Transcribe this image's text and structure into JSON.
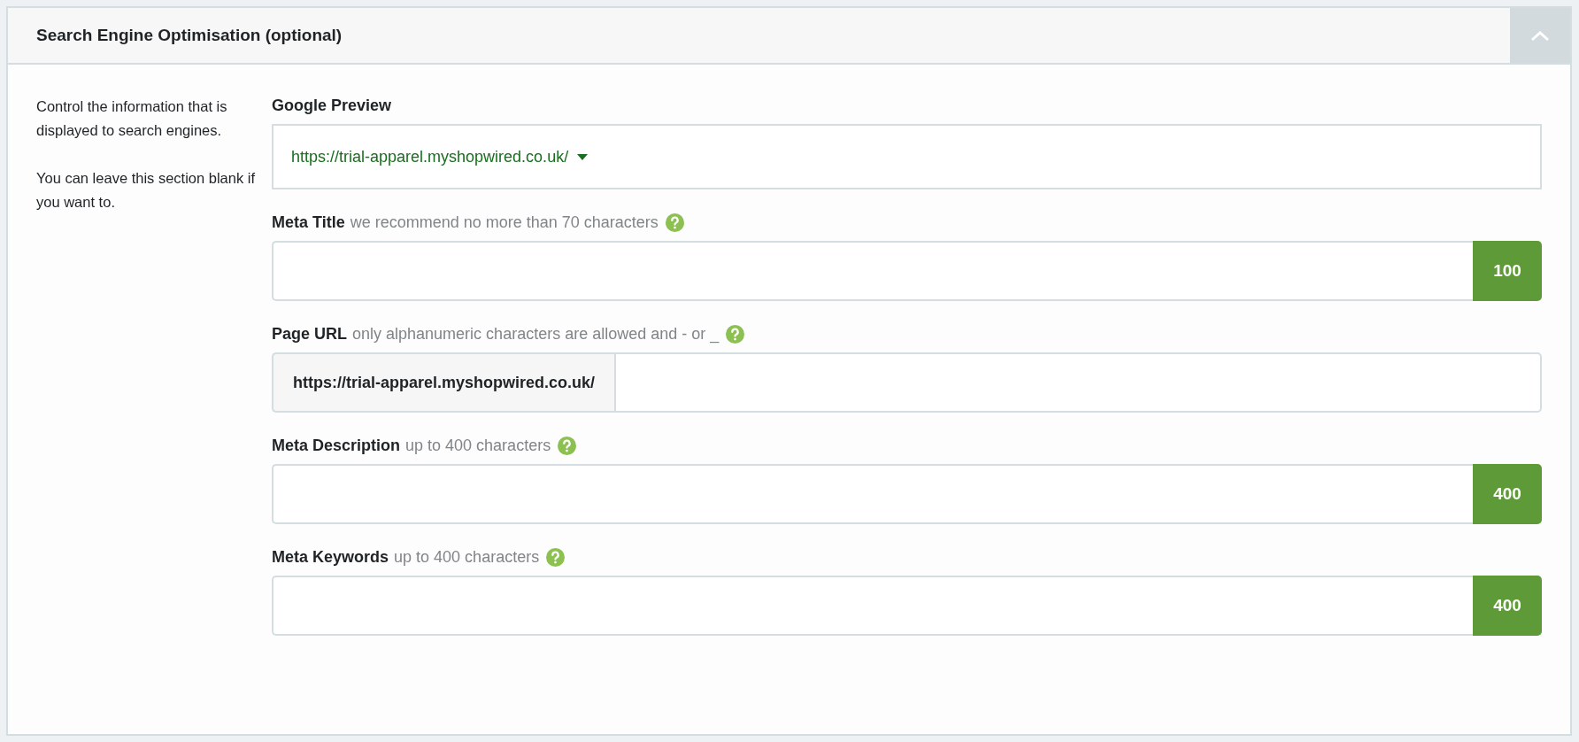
{
  "panel": {
    "title": "Search Engine Optimisation (optional)",
    "expanded": true
  },
  "intro": [
    "Control the information that is displayed to search engines.",
    "You can leave this section blank if you want to."
  ],
  "fields": [
    {
      "kind": "preview",
      "label": "Google Preview",
      "value": "https://trial-apparel.myshopwired.co.uk/"
    },
    {
      "kind": "counter",
      "label": "Meta Title",
      "hint": "we recommend no more than 70 characters",
      "counter": "100"
    },
    {
      "kind": "prefix",
      "label": "Page URL",
      "hint": "only alphanumeric characters are allowed and - or _",
      "prefix": "https://trial-apparel.myshopwired.co.uk/"
    },
    {
      "kind": "counter",
      "label": "Meta Description",
      "hint": "up to 400 characters",
      "counter": "400"
    },
    {
      "kind": "counter",
      "label": "Meta Keywords",
      "hint": "up to 400 characters",
      "counter": "400"
    }
  ]
}
